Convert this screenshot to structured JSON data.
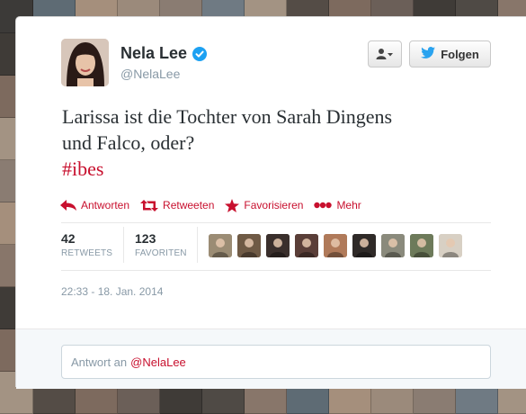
{
  "background": {
    "tile_colors": [
      "#6b5f58",
      "#8a7c72",
      "#4f4a45",
      "#a39383",
      "#5e6b74",
      "#7d6a5e",
      "#9b8a7b",
      "#3f3b37",
      "#6f7a83",
      "#88766a",
      "#544c46",
      "#a58f7c"
    ]
  },
  "profile": {
    "display_name": "Nela Lee",
    "handle": "@NelaLee",
    "verified": true,
    "avatar_icon": "profile-photo"
  },
  "header_buttons": {
    "user_menu_icon": "user-dropdown-icon",
    "follow_label": "Folgen",
    "follow_icon": "twitter-bird-icon"
  },
  "tweet": {
    "text_line1": "Larissa ist die Tochter von Sarah Dingens",
    "text_line2": "und Falco, oder?",
    "hashtag": "#ibes"
  },
  "actions": [
    {
      "label": "Antworten",
      "icon": "reply-arrow-icon"
    },
    {
      "label": "Retweeten",
      "icon": "retweet-icon"
    },
    {
      "label": "Favorisieren",
      "icon": "star-icon"
    },
    {
      "label": "Mehr",
      "icon": "more-dots-icon"
    }
  ],
  "stats": {
    "retweets_count": "42",
    "retweets_label": "RETWEETS",
    "favorites_count": "123",
    "favorites_label": "FAVORITEN"
  },
  "favoriters": [
    {
      "color": "#9b8c74"
    },
    {
      "color": "#6f5a45"
    },
    {
      "color": "#3a2f2c"
    },
    {
      "color": "#5a3e38"
    },
    {
      "color": "#b07a5a"
    },
    {
      "color": "#2f2a28"
    },
    {
      "color": "#8a8a7c"
    },
    {
      "color": "#6d7a5a"
    },
    {
      "color": "#d8d0c4"
    }
  ],
  "timestamp": "22:33 - 18. Jan. 2014",
  "reply": {
    "placeholder_prefix": "Antwort an",
    "mention": "@NelaLee"
  },
  "colors": {
    "accent": "#c8102e",
    "twitter_blue": "#2aa3ef",
    "verified_blue": "#1da1f2"
  }
}
